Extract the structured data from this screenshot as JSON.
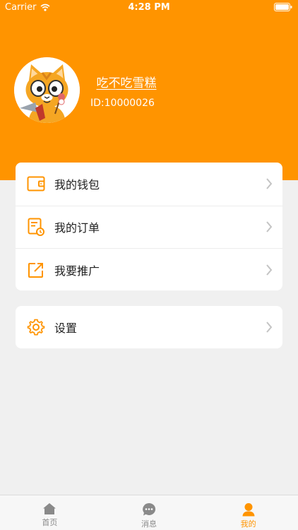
{
  "status_bar": {
    "carrier": "Carrier",
    "time": "4:28 PM"
  },
  "profile": {
    "username": "吃不吃雪糕",
    "id_text": "ID:10000026"
  },
  "menu": {
    "items": [
      {
        "label": "我的钱包",
        "icon": "wallet-icon"
      },
      {
        "label": "我的订单",
        "icon": "order-icon"
      },
      {
        "label": "我要推广",
        "icon": "share-icon"
      }
    ]
  },
  "settings": {
    "label": "设置",
    "icon": "gear-icon"
  },
  "tabbar": {
    "tabs": [
      {
        "label": "首页",
        "icon": "home-icon",
        "active": false
      },
      {
        "label": "消息",
        "icon": "message-icon",
        "active": false
      },
      {
        "label": "我的",
        "icon": "person-icon",
        "active": true
      }
    ]
  },
  "colors": {
    "accent": "#ff9400",
    "background": "#f0f0f0",
    "icon_inactive": "#8a8a8a"
  }
}
